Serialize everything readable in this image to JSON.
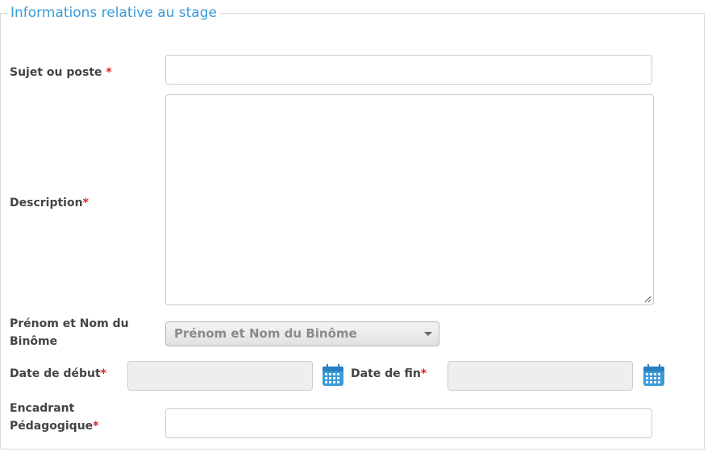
{
  "form": {
    "legend": "Informations relative au stage",
    "required_mark": "*",
    "subject": {
      "label": "Sujet ou poste",
      "value": ""
    },
    "description": {
      "label": "Description",
      "value": ""
    },
    "binome": {
      "label_line1": "Prénom et Nom du",
      "label_line2": "Binôme",
      "selected": "Prénom et Nom du Binôme"
    },
    "start_date": {
      "label": "Date de début",
      "value": ""
    },
    "end_date": {
      "label": "Date de fin",
      "value": ""
    },
    "supervisor": {
      "label_line1": "Encadrant",
      "label_line2": "Pédagogique",
      "value": ""
    }
  },
  "icons": {
    "calendar": "calendar-icon",
    "dropdown": "chevron-down-icon",
    "resize": "resize-handle-icon"
  },
  "colors": {
    "legend": "#3a9ad9",
    "required": "#e02020",
    "calendar": "#3a9ad9"
  }
}
